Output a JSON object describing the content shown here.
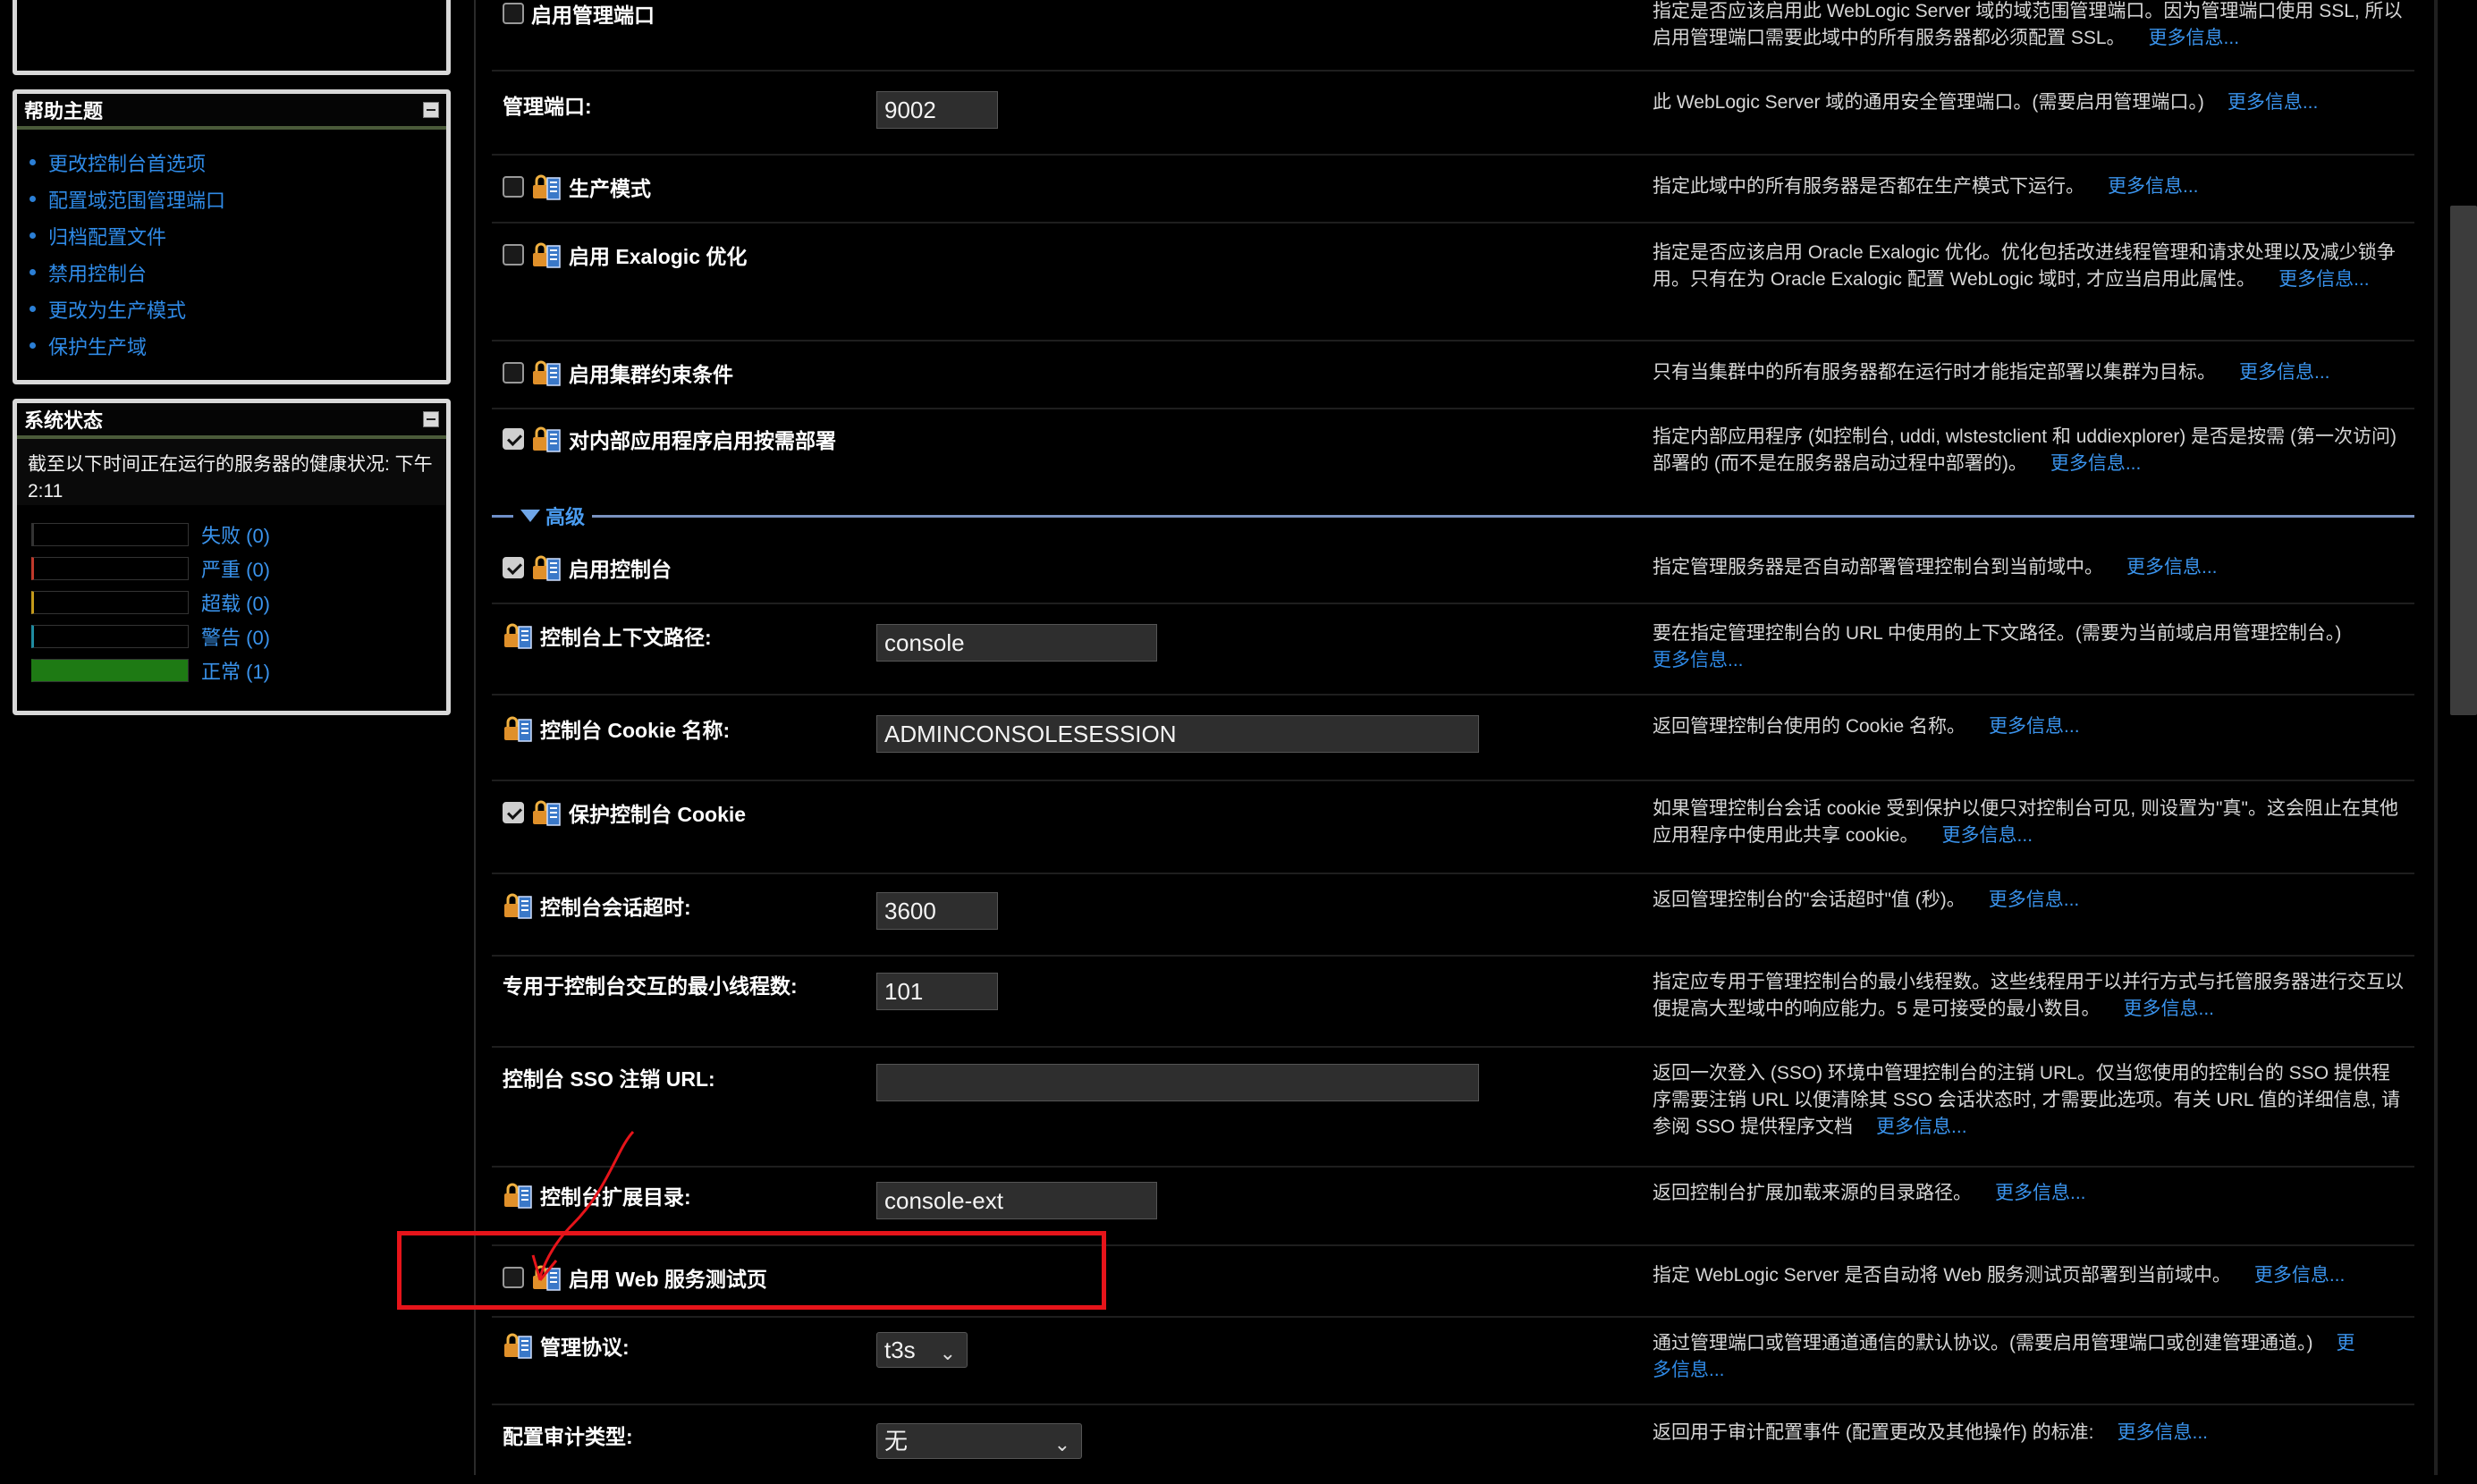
{
  "sidebar": {
    "help": {
      "title": "帮助主题",
      "links": [
        "更改控制台首选项",
        "配置域范围管理端口",
        "归档配置文件",
        "禁用控制台",
        "更改为生产模式",
        "保护生产域"
      ]
    },
    "status": {
      "title": "系统状态",
      "description": "截至以下时间正在运行的服务器的健康状况: 下午2:11",
      "rows": [
        {
          "label": "失败 (0)",
          "color": "#000000",
          "edge": "#333333",
          "fill": 0
        },
        {
          "label": "严重 (0)",
          "color": "#c0392b",
          "edge": "#c0392b",
          "fill": 0
        },
        {
          "label": "超载 (0)",
          "color": "#c49a1a",
          "edge": "#c49a1a",
          "fill": 0
        },
        {
          "label": "警告 (0)",
          "color": "#1f8ba0",
          "edge": "#1f8ba0",
          "fill": 0
        },
        {
          "label": "正常 (1)",
          "color": "#1e7a14",
          "edge": "#1e7a14",
          "fill": 1
        }
      ]
    }
  },
  "more_label": "更多信息...",
  "section_advanced": "高级",
  "rows": {
    "admin_port_enable": {
      "label": "启用管理端口",
      "checked": false,
      "desc": "指定是否应该启用此 WebLogic Server 域的域范围管理端口。因为管理端口使用 SSL, 所以启用管理端口需要此域中的所有服务器都必须配置 SSL。"
    },
    "admin_port": {
      "label": "管理端口:",
      "value": "9002",
      "desc": "此 WebLogic Server 域的通用安全管理端口。(需要启用管理端口。)"
    },
    "production_mode": {
      "label": "生产模式",
      "checked": false,
      "desc": "指定此域中的所有服务器是否都在生产模式下运行。"
    },
    "exalogic": {
      "label": "启用 Exalogic 优化",
      "checked": false,
      "desc_a": "指定是否应该启用 Oracle Exalogic 优化。优化包括改进线程管理和请求处理以及减少锁争用。只有在为 Oracle Exalogic 配置 WebLogic 域时, 才应当启用此属性。",
      "more_a": "更多信",
      "more_b": "息..."
    },
    "cluster_constraints": {
      "label": "启用集群约束条件",
      "checked": false,
      "desc": "只有当集群中的所有服务器都在运行时才能指定部署以集群为目标。"
    },
    "on_demand": {
      "label": "对内部应用程序启用按需部署",
      "checked": true,
      "desc": "指定内部应用程序 (如控制台, uddi, wlstestclient 和 uddiexplorer) 是否是按需 (第一次访问) 部署的 (而不是在服务器启动过程中部署的)。"
    },
    "console_enabled": {
      "label": "启用控制台",
      "checked": true,
      "desc": "指定管理服务器是否自动部署管理控制台到当前域中。"
    },
    "console_context": {
      "label": "控制台上下文路径:",
      "value": "console",
      "desc": "要在指定管理控制台的 URL 中使用的上下文路径。(需要为当前域启用管理控制台。)"
    },
    "console_cookie": {
      "label": "控制台 Cookie 名称:",
      "value": "ADMINCONSOLESESSION",
      "desc": "返回管理控制台使用的 Cookie 名称。"
    },
    "protect_cookie": {
      "label": "保护控制台 Cookie",
      "checked": true,
      "desc": "如果管理控制台会话 cookie 受到保护以便只对控制台可见, 则设置为\"真\"。这会阻止在其他应用程序中使用此共享 cookie。"
    },
    "session_timeout": {
      "label": "控制台会话超时:",
      "value": "3600",
      "desc": "返回管理控制台的\"会话超时\"值 (秒)。"
    },
    "min_threads": {
      "label": "专用于控制台交互的最小线程数:",
      "value": "101",
      "desc": "指定应专用于管理控制台的最小线程数。这些线程用于以并行方式与托管服务器进行交互以便提高大型域中的响应能力。5 是可接受的最小数目。"
    },
    "sso_logout": {
      "label": "控制台 SSO 注销 URL:",
      "value": "",
      "desc": "返回一次登入 (SSO) 环境中管理控制台的注销 URL。仅当您使用的控制台的 SSO 提供程序需要注销 URL 以便清除其 SSO 会话状态时, 才需要此选项。有关 URL 值的详细信息, 请参阅 SSO 提供程序文档"
    },
    "ext_dir": {
      "label": "控制台扩展目录:",
      "value": "console-ext",
      "desc": "返回控制台扩展加载来源的目录路径。"
    },
    "ws_test_page": {
      "label": "启用 Web 服务测试页",
      "checked": false,
      "desc": "指定 WebLogic Server 是否自动将 Web 服务测试页部署到当前域中。"
    },
    "admin_protocol": {
      "label": "管理协议:",
      "value": "t3s",
      "desc_a": "通过管理端口或管理通道通信的默认协议。(需要启用管理端口或创建管理通道。)",
      "more_a": "更",
      "more_b": "多信息..."
    },
    "audit_type": {
      "label": "配置审计类型:",
      "value": "无",
      "desc": "返回用于审计配置事件 (配置更改及其他操作) 的标准:"
    }
  },
  "colors": {
    "link": "#3a93ec",
    "highlight": "#e6141a",
    "background": "#000000"
  }
}
